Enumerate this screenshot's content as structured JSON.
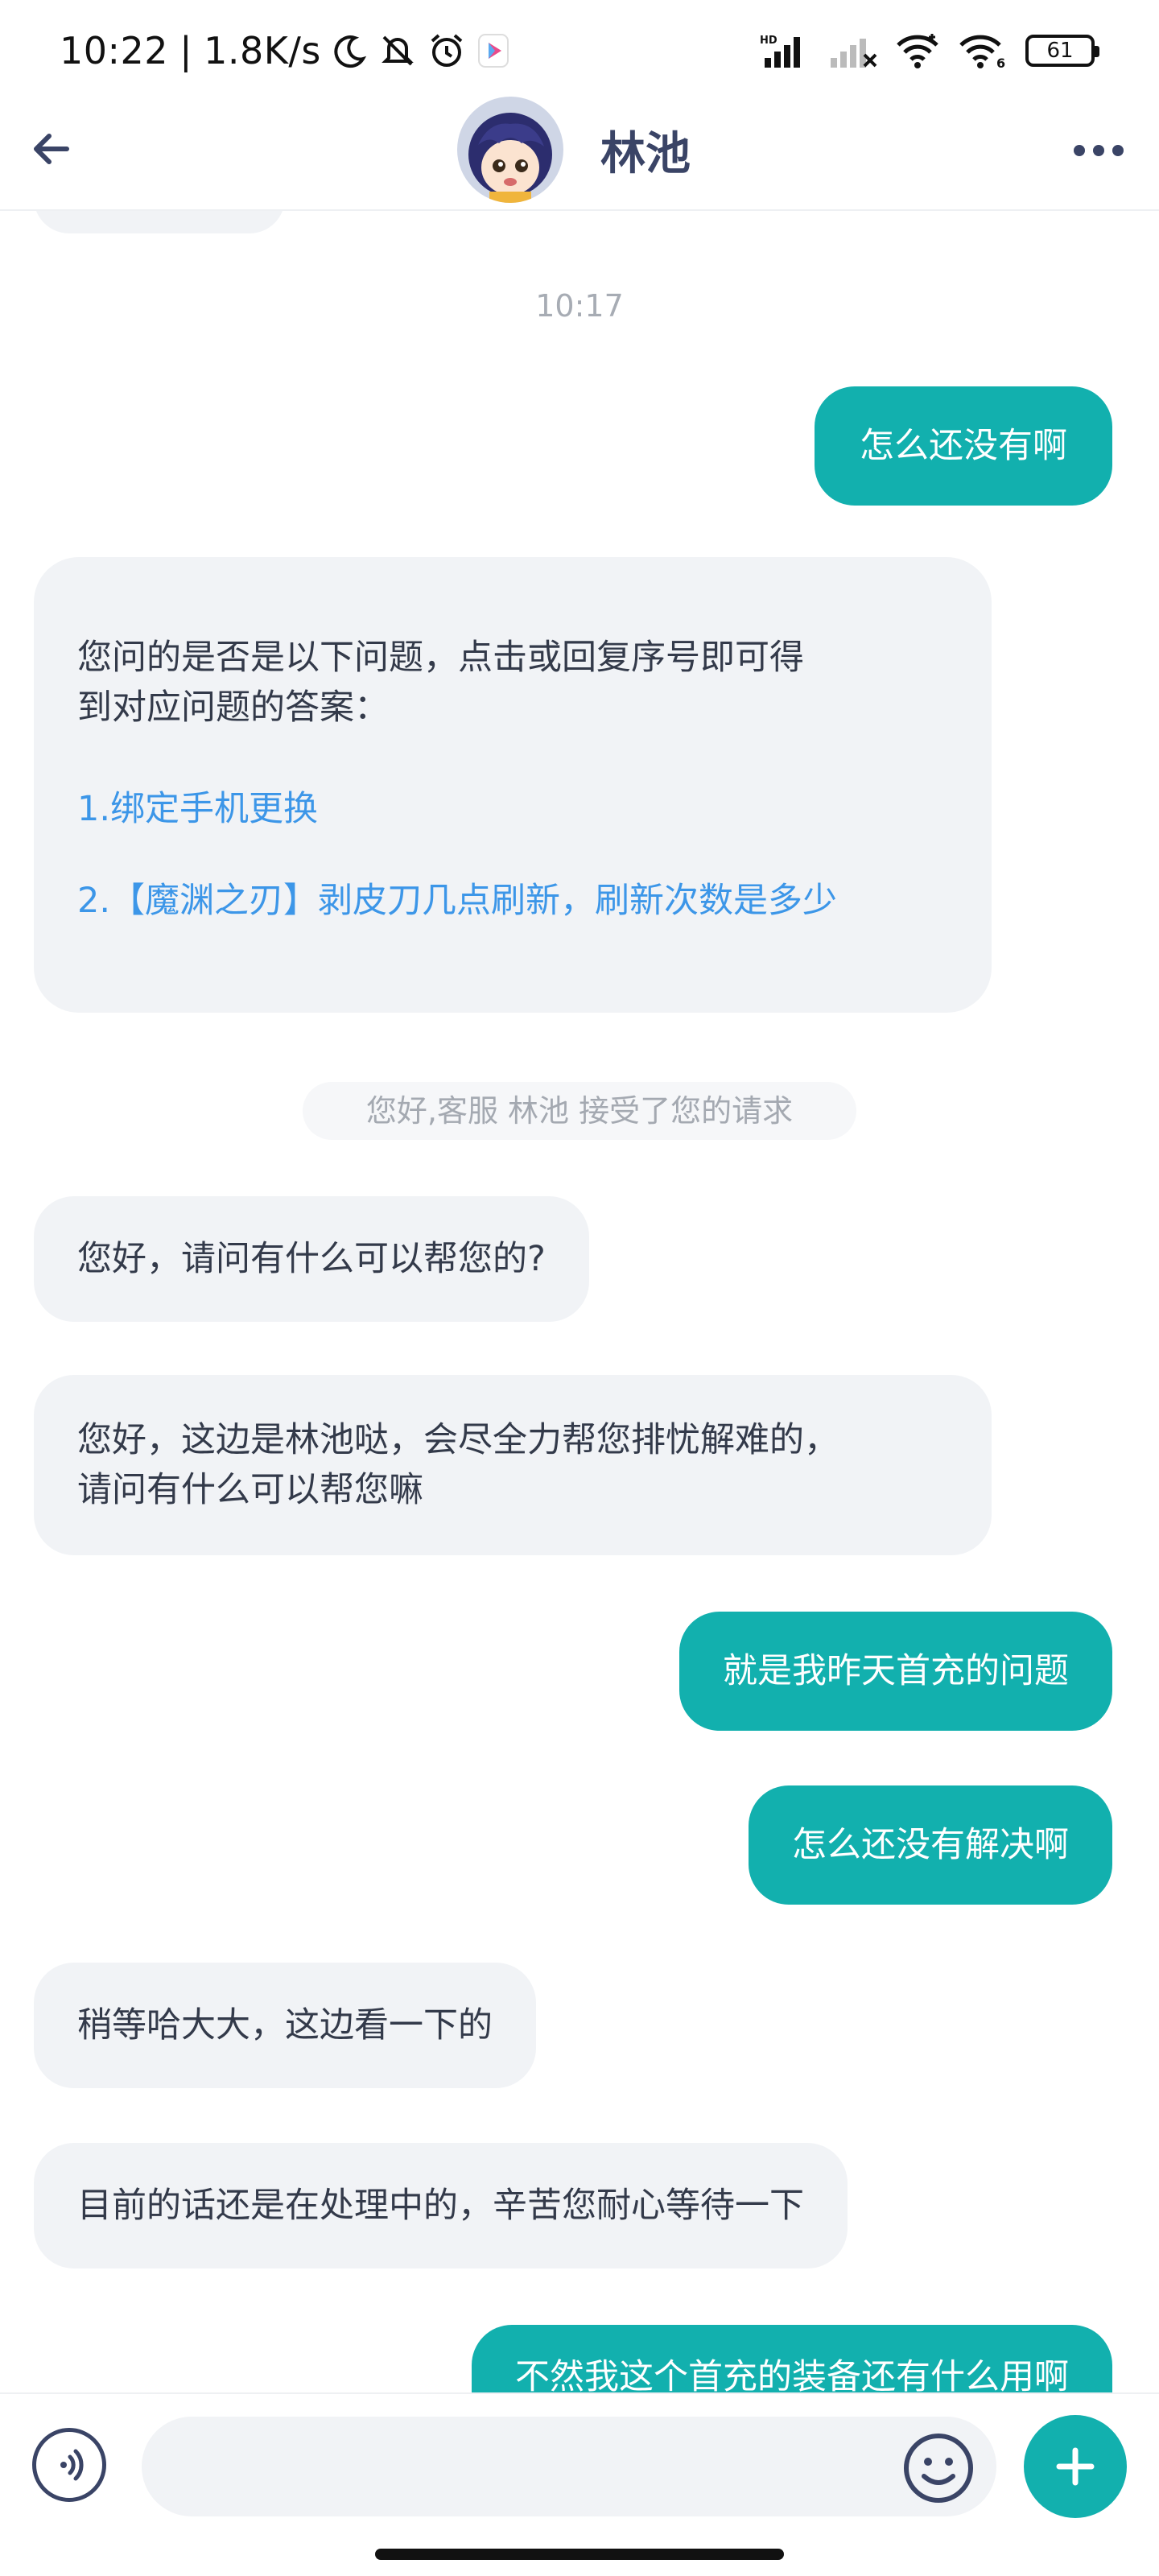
{
  "status_bar": {
    "time": "10:22",
    "speed": "1.8K/s",
    "battery": "61",
    "icons": [
      "moon-icon",
      "bell-off-icon",
      "alarm-icon",
      "app-badge-icon",
      "signal-hd-icon",
      "signal-off-icon",
      "wifi-icon",
      "wifi-6-icon",
      "battery-icon"
    ]
  },
  "header": {
    "title": "林池",
    "back_icon": "arrow-left-icon",
    "more_icon": "more-dots-icon"
  },
  "messages": {
    "time_1": "10:17",
    "m1": "怎么还没有啊",
    "m2_line1": "您问的是否是以下问题，点击或回复序号即可得",
    "m2_line2": "到对应问题的答案：",
    "m2_link1": "1.绑定手机更换",
    "m2_link2": "2.【魔渊之刃】剥皮刀几点刷新，刷新次数是多少",
    "sys_1": "您好,客服 林池 接受了您的请求",
    "m3": "您好，请问有什么可以帮您的?",
    "m4_line1": "您好，这边是林池哒，会尽全力帮您排忧解难的，",
    "m4_line2": "请问有什么可以帮您嘛",
    "m5": "就是我昨天首充的问题",
    "m6": "怎么还没有解决啊",
    "m7": "稍等哈大大，这边看一下的",
    "m8": "目前的话还是在处理中的，辛苦您耐心等待一下",
    "m9": "不然我这个首充的装备还有什么用啊"
  },
  "input_bar": {
    "placeholder": "",
    "voice_icon": "voice-icon",
    "emoji_icon": "emoji-icon",
    "plus_icon": "plus-icon"
  },
  "colors": {
    "accent": "#12b0ae",
    "link": "#3c96e8",
    "bubble_left": "#f1f3f6",
    "title": "#3a4466"
  }
}
